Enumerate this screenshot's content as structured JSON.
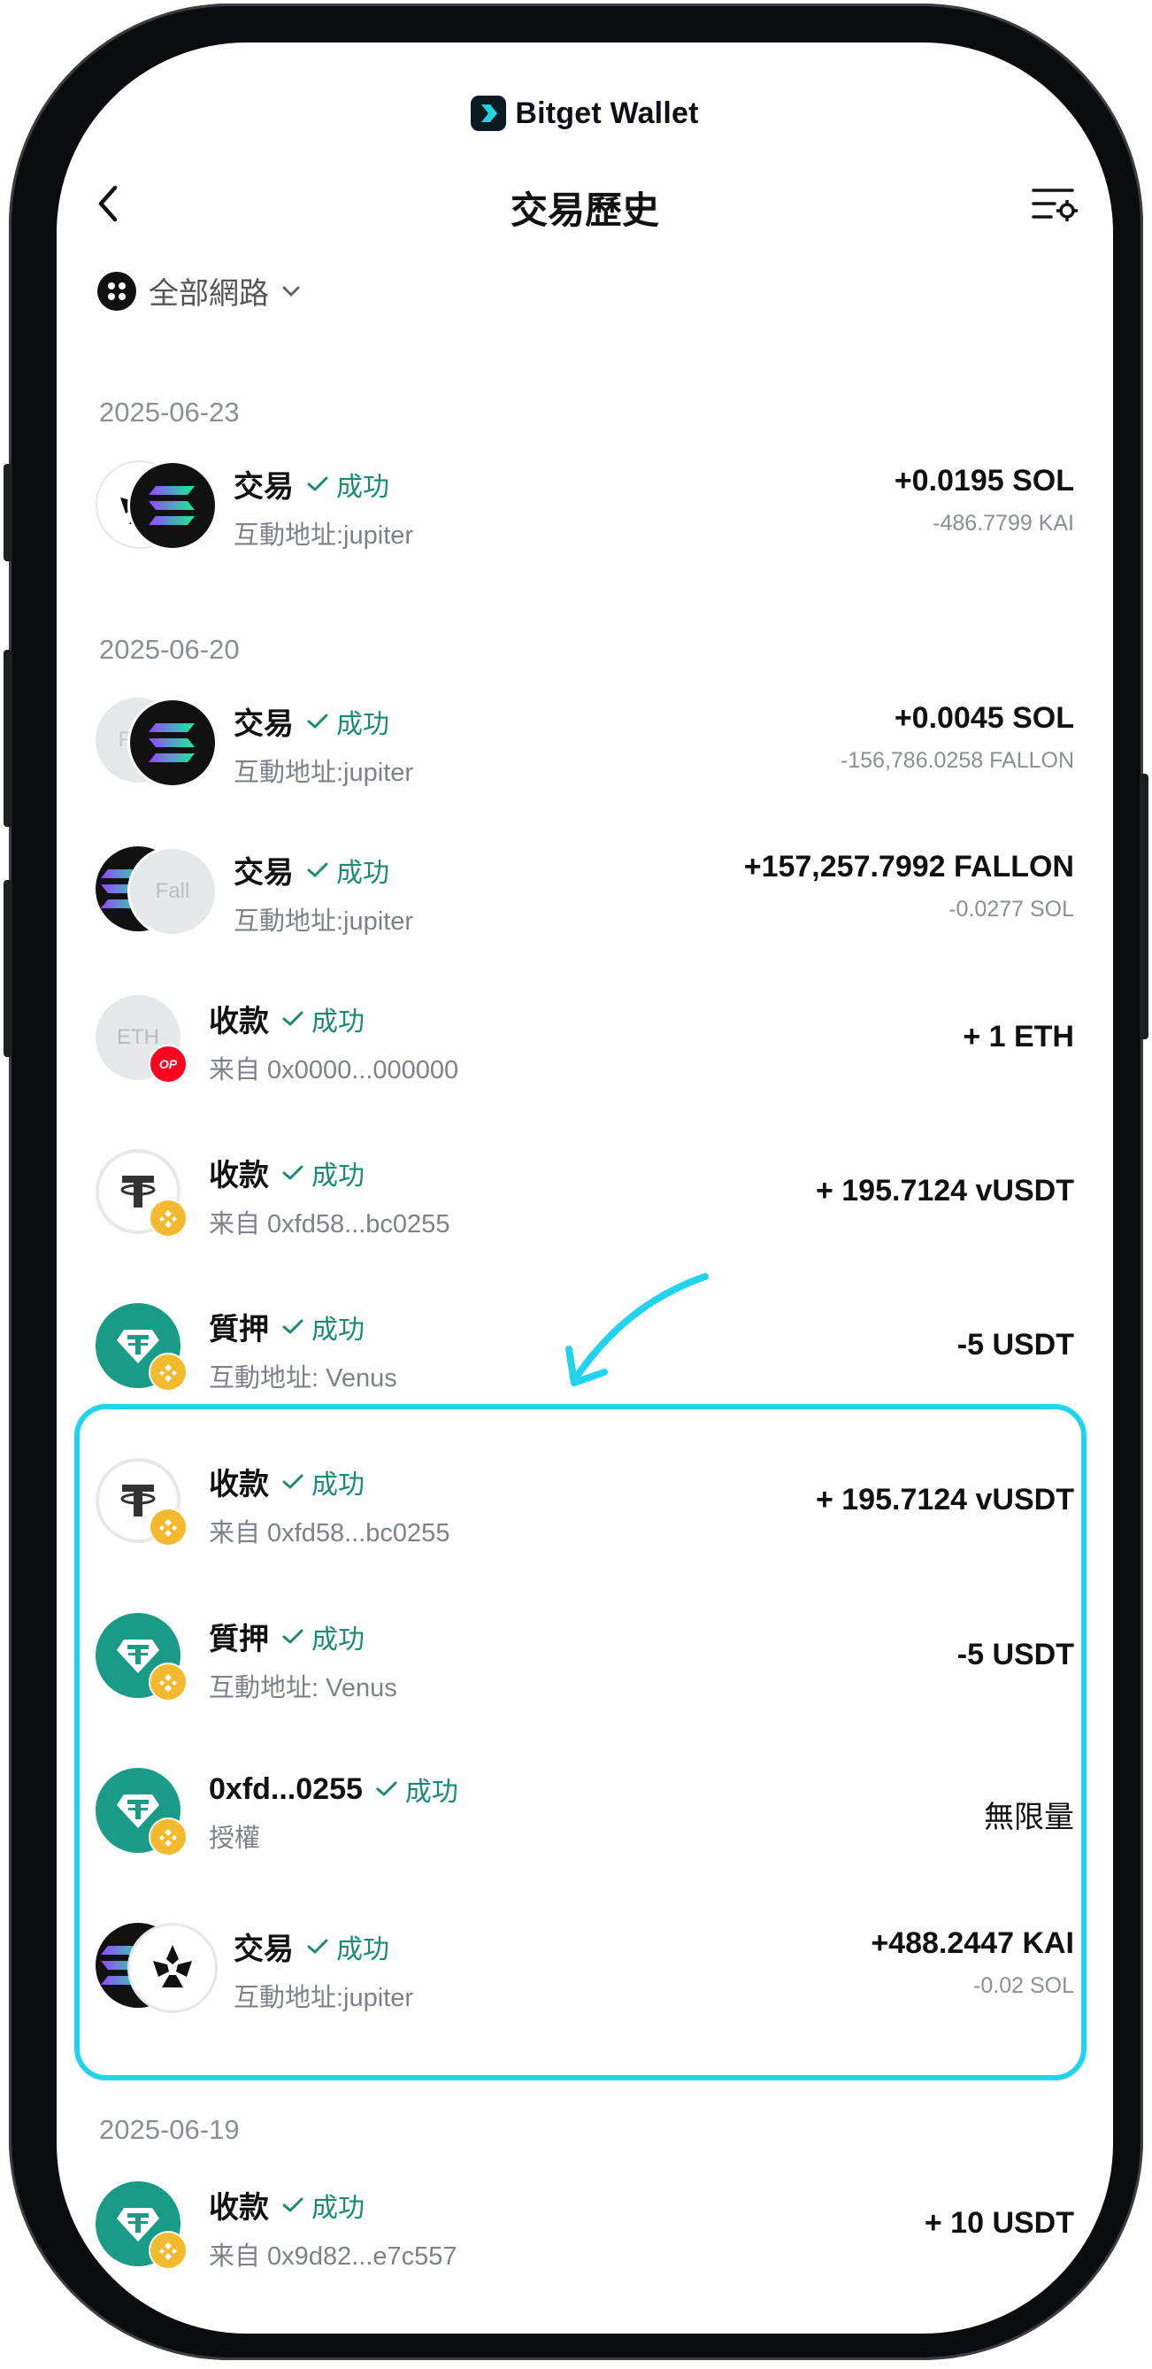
{
  "brand": {
    "name": "Bitget Wallet"
  },
  "header": {
    "title": "交易歷史"
  },
  "network_filter": {
    "label": "全部網路"
  },
  "groups": [
    {
      "date": "2025-06-23",
      "rows": [
        {
          "type": "交易",
          "status": "成功",
          "sub": "互動地址:jupiter",
          "amount": "+0.0195 SOL",
          "amount_sub": "-486.7799 KAI"
        }
      ]
    },
    {
      "date": "2025-06-20",
      "rows": [
        {
          "type": "交易",
          "status": "成功",
          "sub": "互動地址:jupiter",
          "amount": "+0.0045 SOL",
          "amount_sub": "-156,786.0258 FALLON"
        },
        {
          "type": "交易",
          "status": "成功",
          "sub": "互動地址:jupiter",
          "amount": "+157,257.7992 FALLON",
          "amount_sub": "-0.0277 SOL"
        },
        {
          "type": "收款",
          "status": "成功",
          "sub": "来自 0x0000...000000",
          "amount": "+ 1 ETH"
        },
        {
          "type": "收款",
          "status": "成功",
          "sub": "来自 0xfd58...bc0255",
          "amount": "+ 195.7124 vUSDT"
        },
        {
          "type": "質押",
          "status": "成功",
          "sub": "互動地址: Venus",
          "amount": "-5 USDT"
        },
        {
          "type": "收款",
          "status": "成功",
          "sub": "来自 0xfd58...bc0255",
          "amount": "+ 195.7124 vUSDT"
        },
        {
          "type": "質押",
          "status": "成功",
          "sub": "互動地址: Venus",
          "amount": "-5 USDT"
        },
        {
          "type": "0xfd...0255",
          "status": "成功",
          "sub": "授權",
          "amount": "無限量"
        },
        {
          "type": "交易",
          "status": "成功",
          "sub": "互動地址:jupiter",
          "amount": "+488.2447 KAI",
          "amount_sub": "-0.02 SOL"
        }
      ]
    },
    {
      "date": "2025-06-19",
      "rows": [
        {
          "type": "收款",
          "status": "成功",
          "sub": "来自 0x9d82...e7c557",
          "amount": "+ 10 USDT"
        }
      ]
    }
  ],
  "token_labels": {
    "fall": "Fall",
    "f": "F",
    "eth": "ETH",
    "op": "OP"
  },
  "colors": {
    "success": "#1b8a72",
    "highlight": "#22d3ee",
    "tether": "#1a9b87",
    "bnb": "#f3ba2f",
    "op": "#ff0420"
  }
}
